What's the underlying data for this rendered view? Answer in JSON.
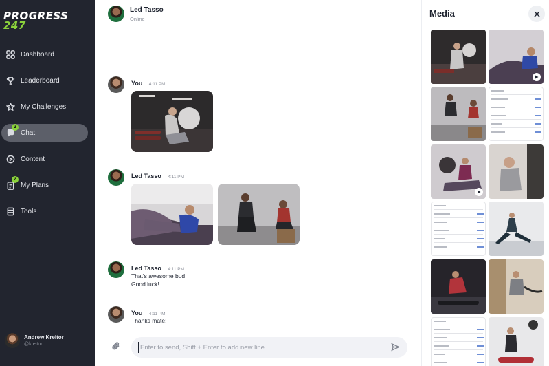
{
  "app": {
    "logo_line1": "PROGRESS",
    "logo_line2": "247"
  },
  "sidebar": {
    "items": [
      {
        "label": "Dashboard",
        "icon": "grid-icon",
        "active": false
      },
      {
        "label": "Leaderboard",
        "icon": "trophy-icon",
        "active": false
      },
      {
        "label": "My Challenges",
        "icon": "star-icon",
        "active": false
      },
      {
        "label": "Chat",
        "icon": "chat-icon",
        "active": true,
        "badge": "2"
      },
      {
        "label": "Content",
        "icon": "play-circle-icon",
        "active": false
      },
      {
        "label": "My Plans",
        "icon": "clipboard-icon",
        "active": false,
        "badge": "2"
      },
      {
        "label": "Tools",
        "icon": "tools-icon",
        "active": false
      }
    ],
    "user": {
      "name": "Andrew Kreitor",
      "handle": "@kreitor"
    }
  },
  "chat": {
    "header": {
      "name": "Led Tasso",
      "status": "Online"
    },
    "messages": [
      {
        "sender": "You",
        "time": "4:11 PM",
        "type": "photos",
        "photos": [
          "woman-gym-machine"
        ]
      },
      {
        "sender": "Led Tasso",
        "time": "4:11 PM",
        "type": "photos",
        "photos": [
          "woman-leg-press",
          "couple-box-squat"
        ]
      },
      {
        "sender": "Led Tasso",
        "time": "4:11 PM",
        "type": "text",
        "lines": [
          "That's awesome bud",
          "Good luck!"
        ]
      },
      {
        "sender": "You",
        "time": "4:11 PM",
        "type": "text",
        "lines": [
          "Thanks mate!"
        ]
      }
    ],
    "composer": {
      "placeholder": "Enter to send, Shift + Enter to add new line"
    }
  },
  "media": {
    "title": "Media",
    "items": [
      {
        "kind": "photo",
        "video": false
      },
      {
        "kind": "photo",
        "video": true
      },
      {
        "kind": "photo",
        "video": false
      },
      {
        "kind": "document",
        "video": false
      },
      {
        "kind": "photo",
        "video": true
      },
      {
        "kind": "photo",
        "video": false
      },
      {
        "kind": "document",
        "video": false
      },
      {
        "kind": "photo",
        "video": false
      },
      {
        "kind": "photo",
        "video": false
      },
      {
        "kind": "photo",
        "video": false
      },
      {
        "kind": "document",
        "video": false
      },
      {
        "kind": "photo",
        "video": false
      }
    ]
  },
  "colors": {
    "sidebar_bg": "#22252f",
    "accent_green": "#8ad13b",
    "active_item_bg": "#5c5f69"
  }
}
